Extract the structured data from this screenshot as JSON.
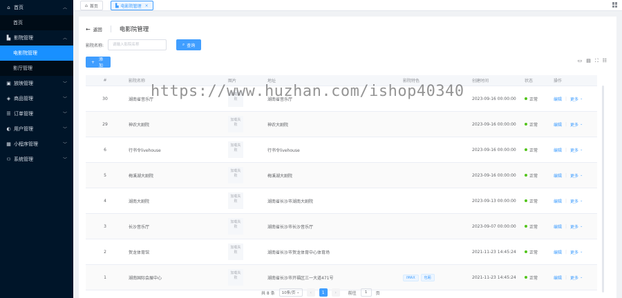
{
  "sidebar": {
    "groups": [
      {
        "label": "首页",
        "icon": "home-icon",
        "expanded": true,
        "children": [
          {
            "label": "首页",
            "active": false
          }
        ]
      },
      {
        "label": "影院管理",
        "icon": "cinema-icon",
        "expanded": true,
        "children": [
          {
            "label": "电影院管理",
            "active": true
          },
          {
            "label": "影厅管理",
            "active": false
          }
        ]
      },
      {
        "label": "放映管理",
        "icon": "film-icon",
        "expanded": false,
        "children": []
      },
      {
        "label": "商品管理",
        "icon": "goods-icon",
        "expanded": false,
        "children": []
      },
      {
        "label": "订单管理",
        "icon": "order-icon",
        "expanded": false,
        "children": []
      },
      {
        "label": "用户管理",
        "icon": "user-icon",
        "expanded": false,
        "children": []
      },
      {
        "label": "小程序管理",
        "icon": "miniapp-icon",
        "expanded": false,
        "children": []
      },
      {
        "label": "系统管理",
        "icon": "system-icon",
        "expanded": false,
        "children": []
      }
    ]
  },
  "tabs": [
    {
      "label": "首页",
      "active": false,
      "closable": false
    },
    {
      "label": "电影院管理",
      "active": true,
      "closable": true
    }
  ],
  "header": {
    "back_label": "返回",
    "title": "电影院管理"
  },
  "search": {
    "label": "影院名称:",
    "placeholder": "请输入影院名称",
    "button_label": "查询"
  },
  "add_button_label": "添加",
  "table": {
    "columns": [
      "#",
      "影院名称",
      "图片",
      "地址",
      "影院特色",
      "创建时间",
      "状态",
      "操作"
    ],
    "image_placeholder": "加载失败",
    "rows": [
      {
        "idx": "30",
        "name": "湖南省音乐厅",
        "address": "湖南省音乐厅",
        "features": [],
        "time": "2023-09-16 00:00:00",
        "status": "正常"
      },
      {
        "idx": "29",
        "name": "神农大剧院",
        "address": "神农大剧院",
        "features": [],
        "time": "2023-09-16 00:00:00",
        "status": "正常"
      },
      {
        "idx": "6",
        "name": "行书令livehouse",
        "address": "行书令livehouse",
        "features": [],
        "time": "2023-09-16 00:00:00",
        "status": "正常"
      },
      {
        "idx": "5",
        "name": "梅溪湖大剧院",
        "address": "梅溪湖大剧院",
        "features": [],
        "time": "2023-09-16 00:00:00",
        "status": "正常"
      },
      {
        "idx": "4",
        "name": "湖南大剧院",
        "address": "湖南省长沙市湖南大剧院",
        "features": [],
        "time": "2023-09-13 00:00:00",
        "status": "正常"
      },
      {
        "idx": "3",
        "name": "长沙音乐厅",
        "address": "湖南省长沙市长沙音乐厅",
        "features": [],
        "time": "2023-09-07 00:00:00",
        "status": "正常"
      },
      {
        "idx": "2",
        "name": "贺龙体育馆",
        "address": "湖南省长沙市贺龙体育中心体育场",
        "features": [],
        "time": "2021-11-23 14:45:24",
        "status": "正常"
      },
      {
        "idx": "1",
        "name": "湖南国际会展中心",
        "address": "湖南省长沙市开福区三一大道471号",
        "features": [
          "IMAX",
          "包厢"
        ],
        "time": "2021-11-23 14:45:24",
        "status": "正常"
      }
    ],
    "op_edit": "编辑",
    "op_more": "更多"
  },
  "pagination": {
    "total_text": "共 8 条",
    "page_size": "10条/页",
    "current_page": "1",
    "goto_label": "前往",
    "goto_value": "1",
    "page_suffix": "页"
  },
  "watermark": "https://www.huzhan.com/ishop40340",
  "colors": {
    "sidebar_bg": "#001529",
    "primary": "#409eff",
    "active_menu": "#1890ff",
    "status_ok": "#52c41a"
  }
}
